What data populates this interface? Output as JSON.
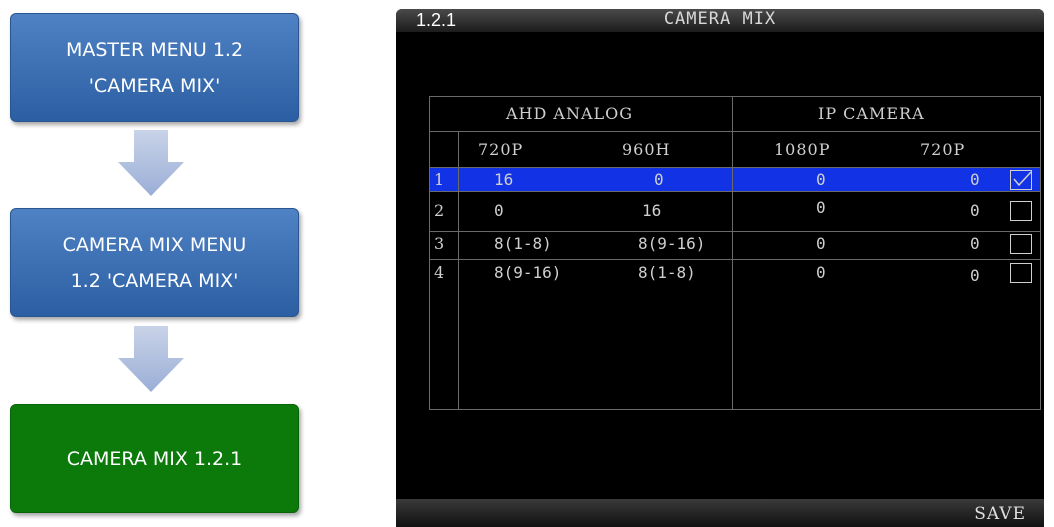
{
  "flow": {
    "step1": {
      "line1": "MASTER MENU 1.2",
      "line2": "'CAMERA MIX'"
    },
    "step2": {
      "line1": "CAMERA MIX MENU",
      "line2": "1.2 'CAMERA MIX'"
    },
    "step3": {
      "line1": "CAMERA MIX 1.2.1"
    }
  },
  "screen": {
    "menu_number": "1.2.1",
    "title": "CAMERA MIX",
    "groups": {
      "analog": "AHD ANALOG",
      "ip": "IP CAMERA"
    },
    "columns": [
      "720P",
      "960H",
      "1080P",
      "720P"
    ],
    "rows": [
      {
        "num": "1",
        "cells": [
          "16",
          "0",
          "0",
          "0"
        ],
        "checked": true,
        "selected": true
      },
      {
        "num": "2",
        "cells": [
          "0",
          "16",
          "0",
          "0"
        ],
        "checked": false,
        "selected": false
      },
      {
        "num": "3",
        "cells": [
          "8(1-8)",
          "8(9-16)",
          "0",
          "0"
        ],
        "checked": false,
        "selected": false
      },
      {
        "num": "4",
        "cells": [
          "8(9-16)",
          "8(1-8)",
          "0",
          "0"
        ],
        "checked": false,
        "selected": false
      }
    ],
    "save_label": "SAVE"
  },
  "colors": {
    "blue_box": "#3b6fb4",
    "green_box": "#0b7a0b",
    "selection": "#1232e6"
  },
  "icons": {
    "arrow": "down-arrow-icon",
    "check": "checkmark-icon"
  }
}
